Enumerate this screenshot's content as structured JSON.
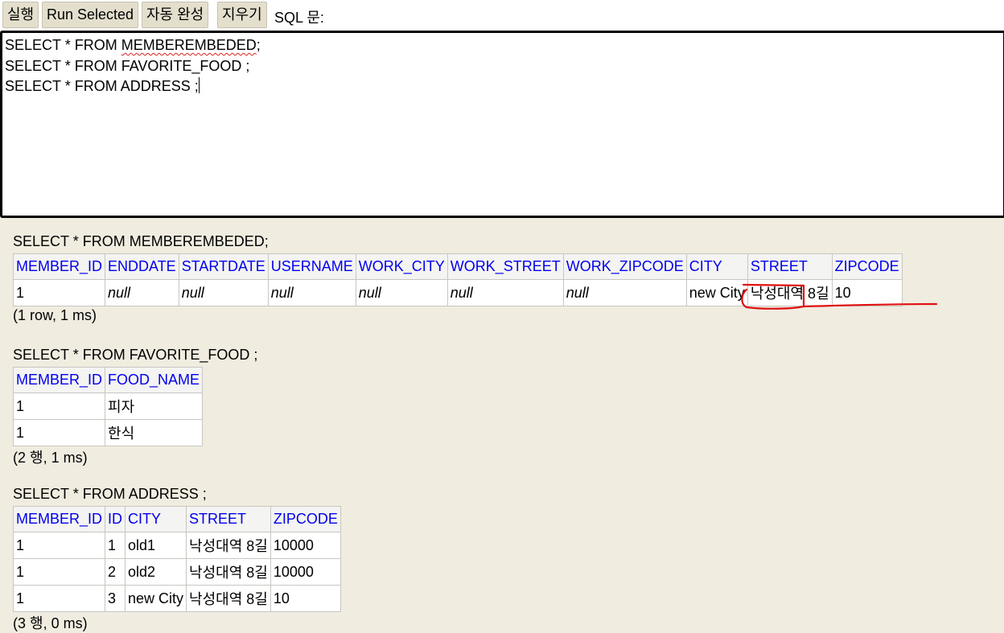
{
  "toolbar": {
    "run_label": "실행",
    "run_selected_label": "Run Selected",
    "autocomplete_label": "자동 완성",
    "clear_label": "지우기",
    "sql_label": "SQL 문:"
  },
  "editor": {
    "line1_prefix": "SELECT * FROM ",
    "line1_table": "MEMBEREMBEDED",
    "line1_suffix": ";",
    "line2": "SELECT * FROM FAVORITE_FOOD ;",
    "line3": "SELECT * FROM ADDRESS ;"
  },
  "results": [
    {
      "query": "SELECT * FROM MEMBEREMBEDED;",
      "columns": [
        "MEMBER_ID",
        "ENDDATE",
        "STARTDATE",
        "USERNAME",
        "WORK_CITY",
        "WORK_STREET",
        "WORK_ZIPCODE",
        "CITY",
        "STREET",
        "ZIPCODE"
      ],
      "rows": [
        [
          "1",
          "null",
          "null",
          "null",
          "null",
          "null",
          "null",
          "new City",
          "낙성대역 8길",
          "10"
        ]
      ],
      "footer": "(1 row, 1 ms)"
    },
    {
      "query": "SELECT * FROM FAVORITE_FOOD ;",
      "columns": [
        "MEMBER_ID",
        "FOOD_NAME"
      ],
      "rows": [
        [
          "1",
          "피자"
        ],
        [
          "1",
          "한식"
        ]
      ],
      "footer": "(2 행, 1 ms)"
    },
    {
      "query": "SELECT * FROM ADDRESS ;",
      "columns": [
        "MEMBER_ID",
        "ID",
        "CITY",
        "STREET",
        "ZIPCODE"
      ],
      "rows": [
        [
          "1",
          "1",
          "old1",
          "낙성대역 8길",
          "10000"
        ],
        [
          "1",
          "2",
          "old2",
          "낙성대역 8길",
          "10000"
        ],
        [
          "1",
          "3",
          "new City",
          "낙성대역 8길",
          "10"
        ]
      ],
      "footer": "(3 행, 0 ms)"
    }
  ],
  "colors": {
    "background": "#f0ece0",
    "header_text": "#0000ee",
    "button_bg": "#e4dfcd",
    "annotation": "#e01010"
  }
}
